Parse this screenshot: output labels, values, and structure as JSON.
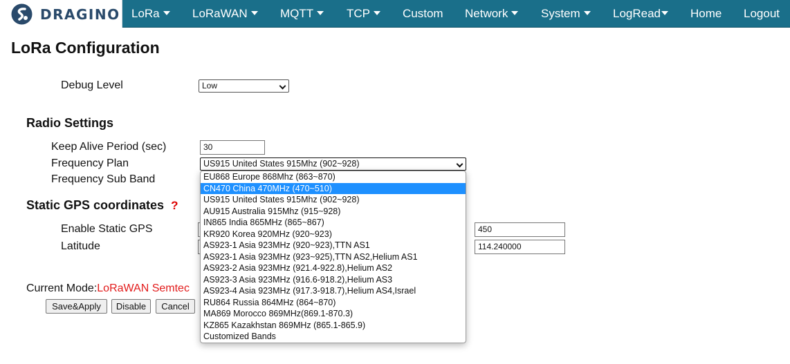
{
  "logo": {
    "text": "DRAGINO"
  },
  "nav": [
    {
      "label": "LoRa",
      "dropdown": true
    },
    {
      "label": "LoRaWAN",
      "dropdown": true
    },
    {
      "label": "MQTT",
      "dropdown": true
    },
    {
      "label": "TCP",
      "dropdown": true
    },
    {
      "label": "Custom",
      "dropdown": false
    },
    {
      "label": "Network",
      "dropdown": true
    },
    {
      "label": "System",
      "dropdown": true
    },
    {
      "label": "LogRead",
      "dropdown": true
    },
    {
      "label": "Home",
      "dropdown": false
    },
    {
      "label": "Logout",
      "dropdown": false
    }
  ],
  "page": {
    "title": "LoRa Configuration"
  },
  "debug": {
    "label": "Debug Level",
    "value": "Low"
  },
  "radio": {
    "title": "Radio Settings",
    "keep_alive_label": "Keep Alive Period (sec)",
    "keep_alive_value": "30",
    "freq_plan_label": "Frequency Plan",
    "freq_plan_value": "US915 United States 915Mhz (902~928)",
    "sub_band_label": "Frequency Sub Band"
  },
  "gps": {
    "title": "Static GPS coordinates",
    "help": "?",
    "enable_label": "Enable Static GPS",
    "latitude_label": "Latitude",
    "field1_value": "450",
    "field2_value": "114.240000"
  },
  "mode": {
    "label": "Current Mode:",
    "value": "LoRaWAN Semtec"
  },
  "buttons": {
    "save": "Save&Apply",
    "disable": "Disable",
    "cancel": "Cancel"
  },
  "frequency_options": [
    "EU868 Europe 868Mhz (863~870)",
    "CN470 China 470MHz (470~510)",
    "US915 United States 915Mhz (902~928)",
    "AU915 Australia 915Mhz (915~928)",
    "IN865 India 865MHz (865~867)",
    "KR920 Korea 920MHz (920~923)",
    "AS923-1 Asia 923MHz (920~923),TTN AS1",
    "AS923-1 Asia 923MHz (923~925),TTN AS2,Helium AS1",
    "AS923-2 Asia 923MHz (921.4-922.8),Helium AS2",
    "AS923-3 Asia 923MHz (916.6-918.2),Helium AS3",
    "AS923-4 Asia 923MHz (917.3-918.7),Helium AS4,Israel",
    "RU864 Russia 864MHz (864~870)",
    "MA869 Morocco 869MHz(869.1-870.3)",
    "KZ865 Kazakhstan 869MHz (865.1-865.9)",
    "Customized Bands"
  ],
  "highlighted_option": "CN470 China 470MHz (470~510)"
}
